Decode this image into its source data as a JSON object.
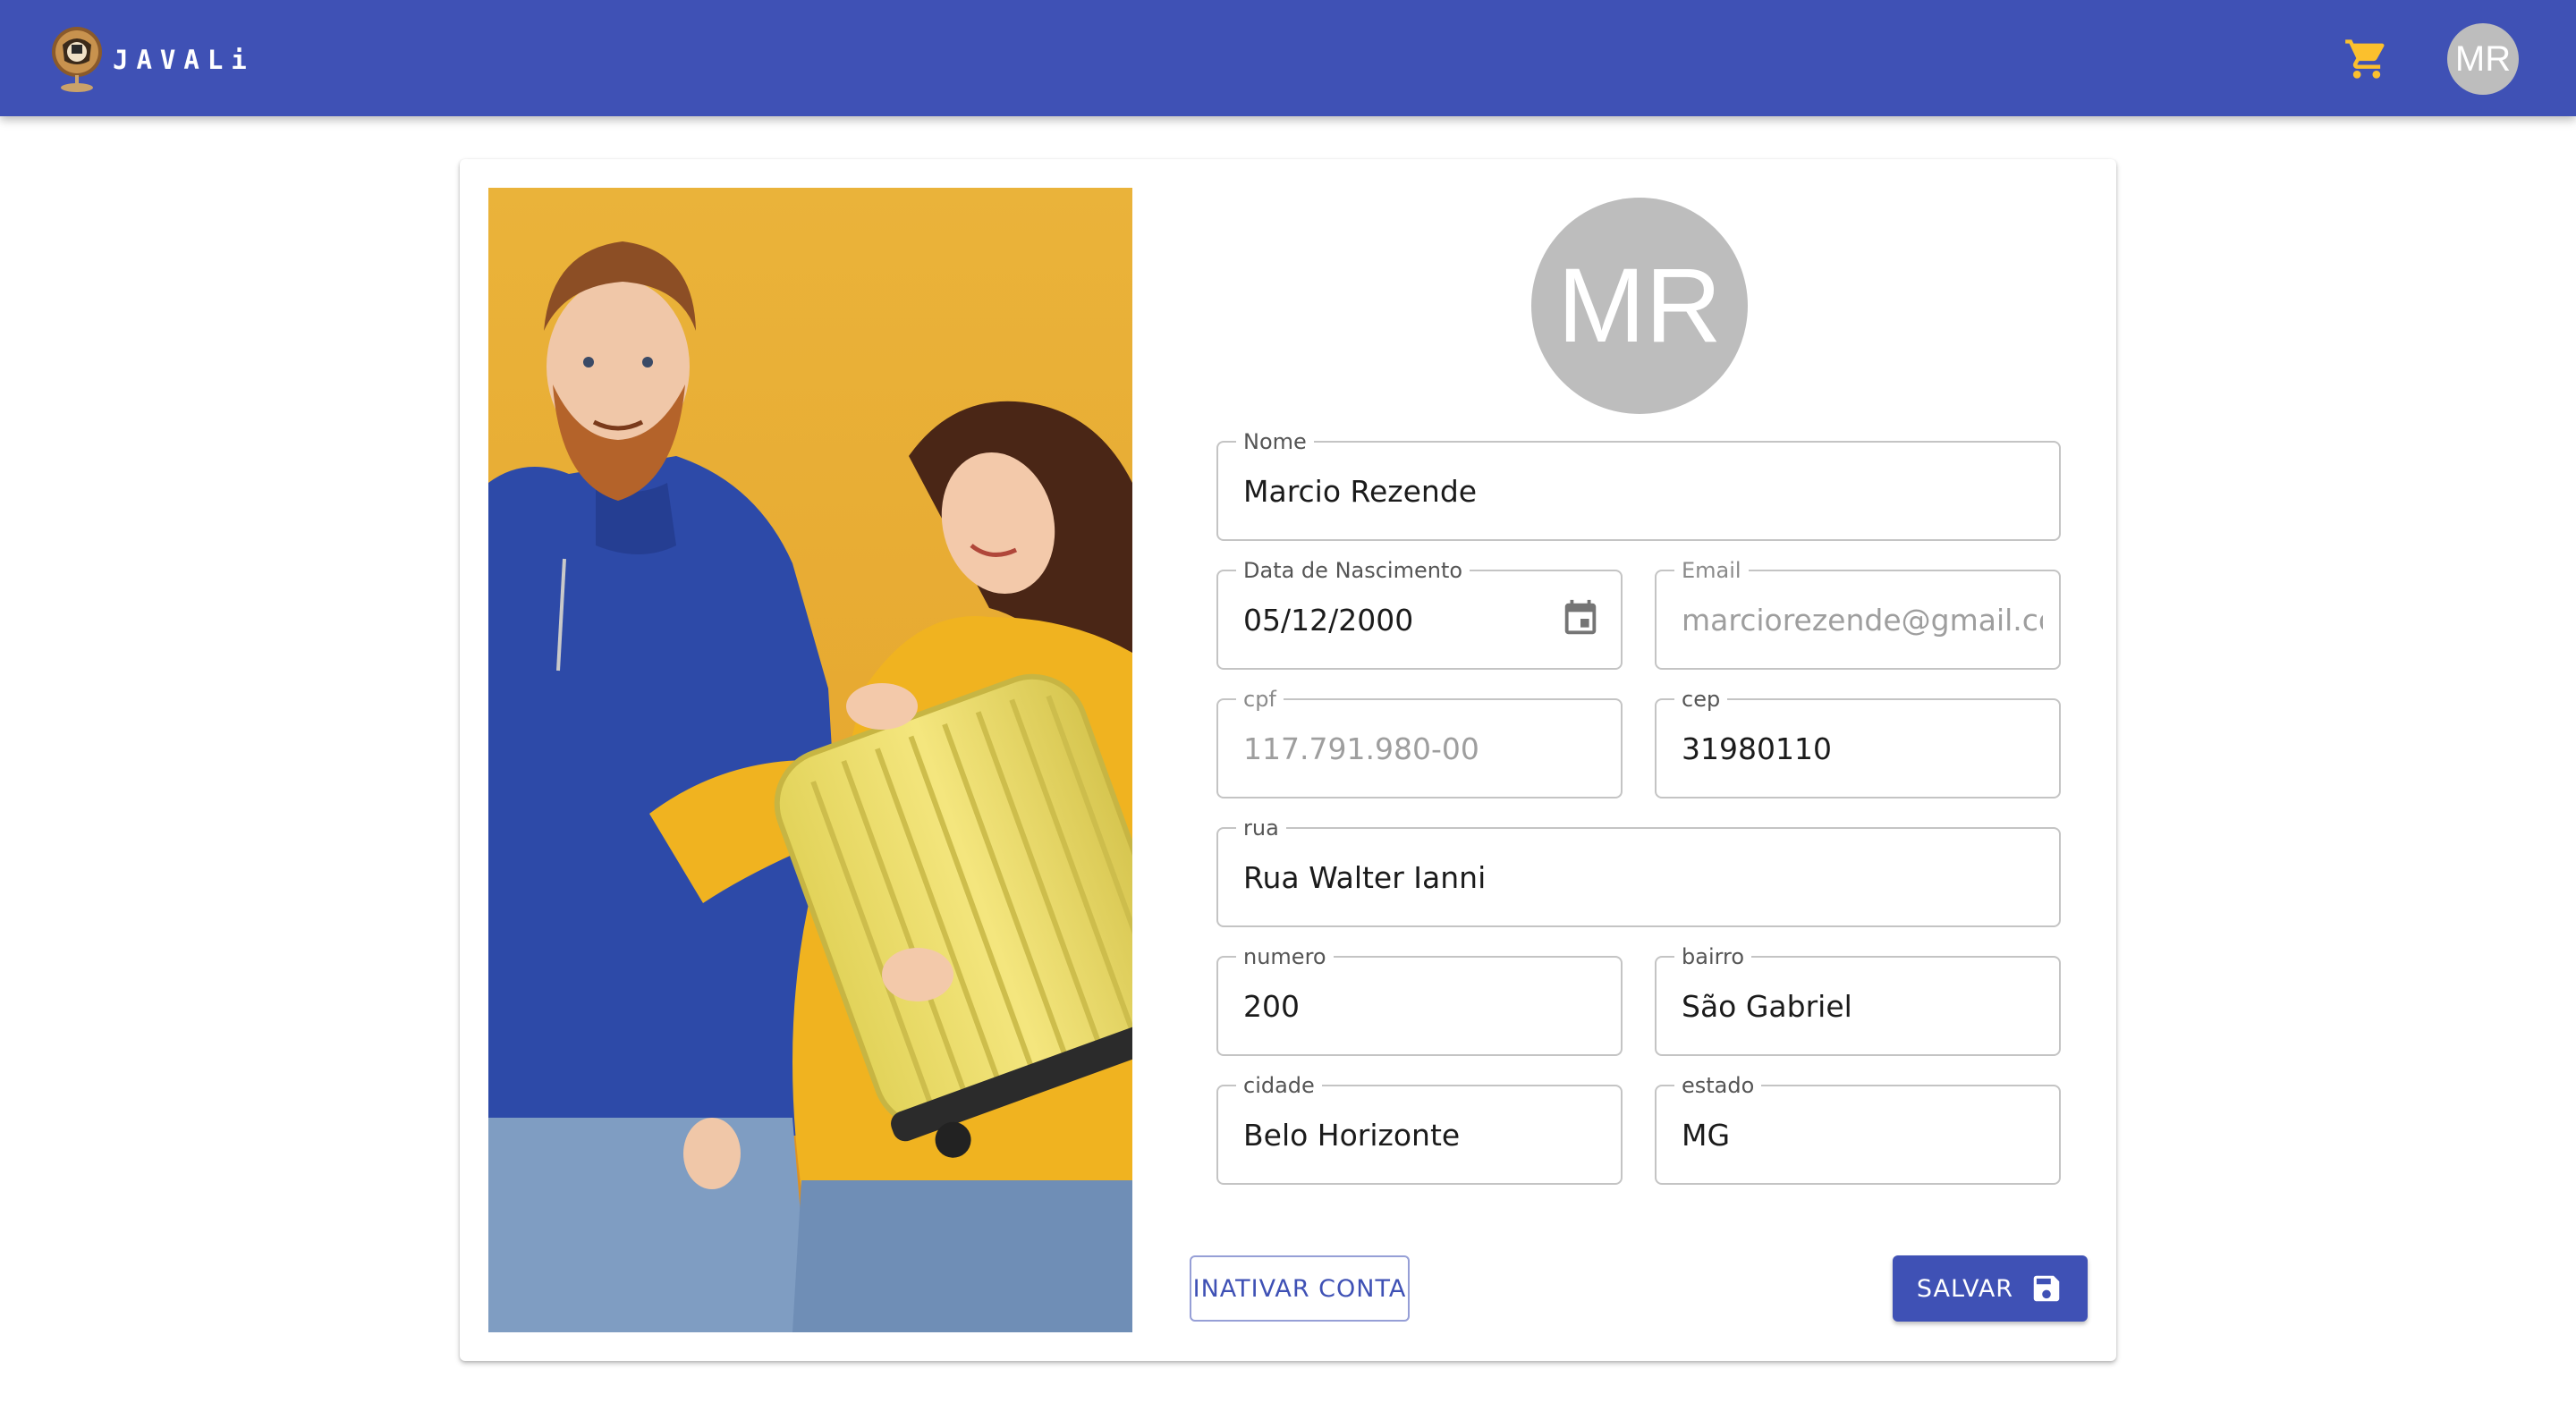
{
  "header": {
    "brand": "JAVALi",
    "logo_icon": "globe-bust-logo",
    "cart_icon": "shopping-cart-icon",
    "avatar_initials": "MR",
    "colors": {
      "appbar": "#3f51b5",
      "cart": "#fbc02d",
      "avatar": "#bdbdbd"
    }
  },
  "profile": {
    "avatar_initials": "MR",
    "photo_alt": "couple-with-yellow-suitcase-photo"
  },
  "form": {
    "nome": {
      "label": "Nome",
      "value": "Marcio Rezende"
    },
    "data_nascimento": {
      "label": "Data de Nascimento",
      "value": "05/12/2000",
      "icon": "calendar-icon"
    },
    "email": {
      "label": "Email",
      "value": "marciorezende@gmail.com",
      "disabled": true
    },
    "cpf": {
      "label": "cpf",
      "value": "117.791.980-00",
      "disabled": true
    },
    "cep": {
      "label": "cep",
      "value": "31980110"
    },
    "rua": {
      "label": "rua",
      "value": "Rua Walter Ianni"
    },
    "numero": {
      "label": "numero",
      "value": "200"
    },
    "bairro": {
      "label": "bairro",
      "value": "São Gabriel"
    },
    "cidade": {
      "label": "cidade",
      "value": "Belo Horizonte"
    },
    "estado": {
      "label": "estado",
      "value": "MG"
    }
  },
  "actions": {
    "inativar_label": "INATIVAR CONTA",
    "salvar_label": "SALVAR",
    "salvar_icon": "save-icon"
  }
}
